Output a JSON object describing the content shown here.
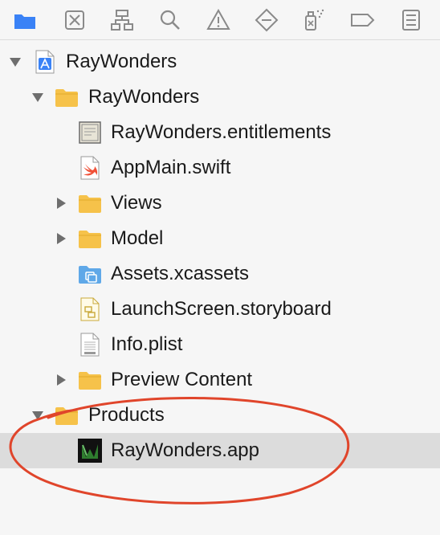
{
  "navigator": {
    "items": [
      {
        "label": "RayWonders"
      },
      {
        "label": "RayWonders"
      },
      {
        "label": "RayWonders.entitlements"
      },
      {
        "label": "AppMain.swift"
      },
      {
        "label": "Views"
      },
      {
        "label": "Model"
      },
      {
        "label": "Assets.xcassets"
      },
      {
        "label": "LaunchScreen.storyboard"
      },
      {
        "label": "Info.plist"
      },
      {
        "label": "Preview Content"
      },
      {
        "label": "Products"
      },
      {
        "label": "RayWonders.app"
      }
    ]
  },
  "icons": {
    "toolbar": [
      "folder-icon",
      "source-control-icon",
      "hierarchy-icon",
      "search-icon",
      "warning-icon",
      "test-diamond-icon",
      "debug-spray-icon",
      "breakpoint-tag-icon",
      "report-list-icon"
    ],
    "files": [
      "xcode-project-icon",
      "folder-icon",
      "entitlements-certificate-icon",
      "swift-file-icon",
      "assets-catalog-icon",
      "storyboard-file-icon",
      "plist-file-icon",
      "app-product-icon"
    ]
  },
  "colors": {
    "folder": "#f6c24a",
    "project": "#3a82f6",
    "swift": "#f05138",
    "selection": "#dcdcdc",
    "annotation": "#e0452b",
    "toolbar_active": "#3a82f6"
  }
}
